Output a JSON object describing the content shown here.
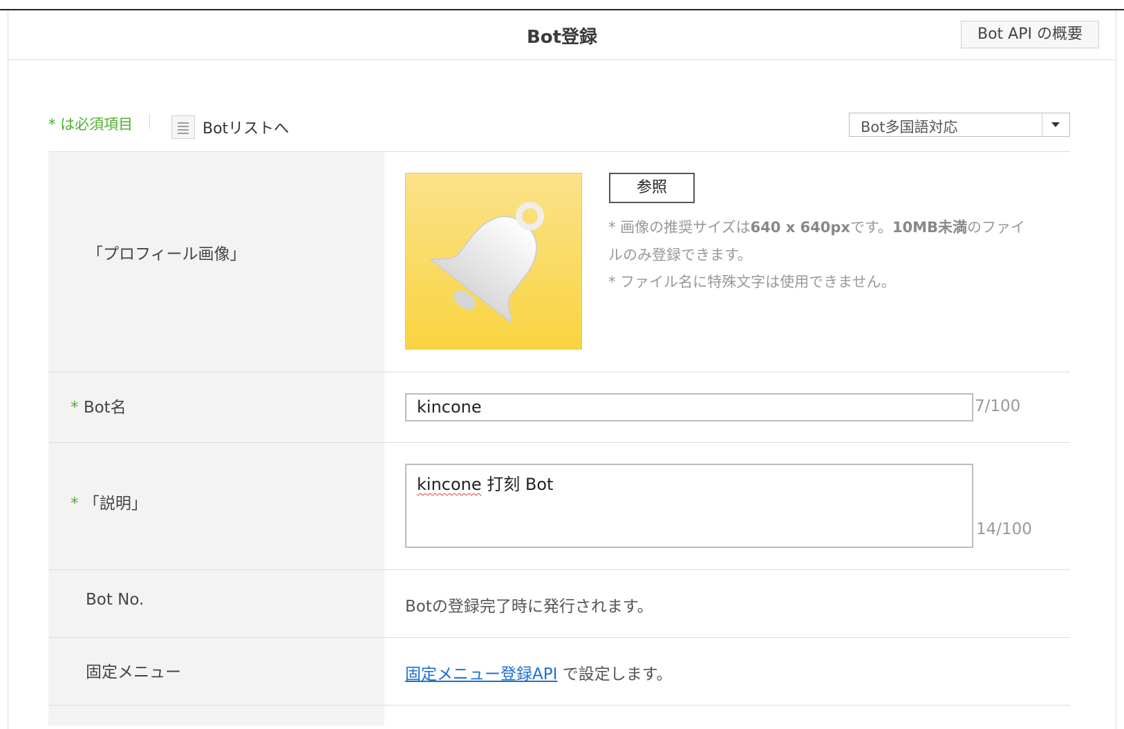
{
  "header": {
    "title": "Bot登録",
    "api_overview_button": "Bot API の概要"
  },
  "toolbar": {
    "required_note": "* は必須項目",
    "bot_list_link": "Botリストへ",
    "language_select": {
      "selected": "Bot多国語対応"
    }
  },
  "form": {
    "profile_image": {
      "label": "「プロフィール画像」",
      "browse_button": "参照",
      "notes": [
        {
          "prefix": "* 画像の推奨サイズは",
          "bold1": "640 x 640px",
          "mid": "です。",
          "bold2": "10MB未満",
          "suffix": "のファイ"
        },
        "ルのみ登録できます。",
        "* ファイル名に特殊文字は使用できません。"
      ],
      "icon": "bell-icon"
    },
    "bot_name": {
      "required_mark": "*",
      "label": "Bot名",
      "value": "kincone",
      "counter": "7/100"
    },
    "description": {
      "required_mark": "*",
      "label": "「説明」",
      "value_word1": "kincone",
      "value_rest": " 打刻 Bot",
      "counter": "14/100"
    },
    "bot_no": {
      "label": "Bot No.",
      "value": "Botの登録完了時に発行されます。"
    },
    "fixed_menu": {
      "label": "固定メニュー",
      "link_text": "固定メニュー登録API",
      "suffix": " で設定します。"
    }
  },
  "colors": {
    "accent_green": "#4caf2c",
    "link_blue": "#1b6fd1",
    "label_bg": "#f3f3f3",
    "image_yellow": "#f9d440"
  }
}
